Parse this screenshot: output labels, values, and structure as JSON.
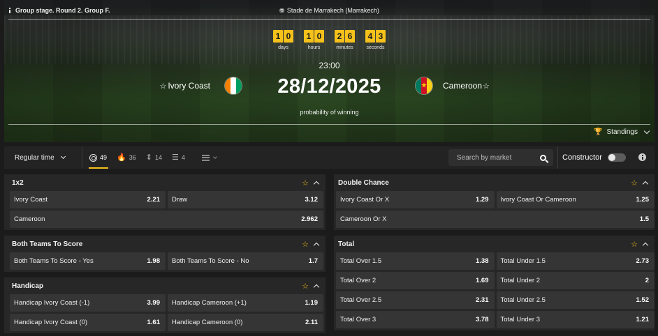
{
  "header": {
    "stage": "Group stage. Round 2. Group F.",
    "stadium": "Stade de Marrakech (Marrakech)",
    "countdown": [
      {
        "d1": "1",
        "d2": "0",
        "label": "days"
      },
      {
        "d1": "1",
        "d2": "0",
        "label": "hours"
      },
      {
        "d1": "2",
        "d2": "6",
        "label": "minutes"
      },
      {
        "d1": "4",
        "d2": "3",
        "label": "seconds"
      }
    ],
    "time": "23:00",
    "date": "28/12/2025",
    "home_team": "Ivory Coast",
    "away_team": "Cameroon",
    "probability_label": "probability of winning",
    "standings_label": "Standings"
  },
  "filter": {
    "period": "Regular time",
    "counters": [
      {
        "icon": "target-icon",
        "count": "49"
      },
      {
        "icon": "fire-icon",
        "count": "36"
      },
      {
        "icon": "up-down-icon",
        "count": "14"
      },
      {
        "icon": "stats-bars-icon",
        "count": "4"
      }
    ],
    "search_placeholder": "Search by market",
    "constructor_label": "Constructor"
  },
  "markets_left": [
    {
      "title": "1x2",
      "rows": [
        {
          "label": "Ivory Coast",
          "odd": "2.21"
        },
        {
          "label": "Draw",
          "odd": "3.12"
        },
        {
          "label": "Cameroon",
          "odd": "2.962",
          "full": true
        }
      ]
    },
    {
      "title": "Both Teams To Score",
      "rows": [
        {
          "label": "Both Teams To Score - Yes",
          "odd": "1.98"
        },
        {
          "label": "Both Teams To Score - No",
          "odd": "1.7"
        }
      ]
    },
    {
      "title": "Handicap",
      "rows": [
        {
          "label": "Handicap Ivory Coast (-1)",
          "odd": "3.99"
        },
        {
          "label": "Handicap Cameroon (+1)",
          "odd": "1.19"
        },
        {
          "label": "Handicap Ivory Coast (0)",
          "odd": "1.61"
        },
        {
          "label": "Handicap Cameroon (0)",
          "odd": "2.11"
        }
      ]
    }
  ],
  "markets_right": [
    {
      "title": "Double Chance",
      "rows": [
        {
          "label": "Ivory Coast Or X",
          "odd": "1.29"
        },
        {
          "label": "Ivory Coast Or Cameroon",
          "odd": "1.25"
        },
        {
          "label": "Cameroon Or X",
          "odd": "1.5",
          "full": true
        }
      ]
    },
    {
      "title": "Total",
      "rows": [
        {
          "label": "Total Over 1.5",
          "odd": "1.38"
        },
        {
          "label": "Total Under 1.5",
          "odd": "2.73"
        },
        {
          "label": "Total Over 2",
          "odd": "1.69"
        },
        {
          "label": "Total Under 2",
          "odd": "2"
        },
        {
          "label": "Total Over 2.5",
          "odd": "2.31"
        },
        {
          "label": "Total Under 2.5",
          "odd": "1.52"
        },
        {
          "label": "Total Over 3",
          "odd": "3.78"
        },
        {
          "label": "Total Under 3",
          "odd": "1.21"
        }
      ]
    }
  ],
  "colors": {
    "accent": "#f5c11a",
    "panel": "#272727",
    "cell": "#353535",
    "background": "#1b1b1b"
  }
}
